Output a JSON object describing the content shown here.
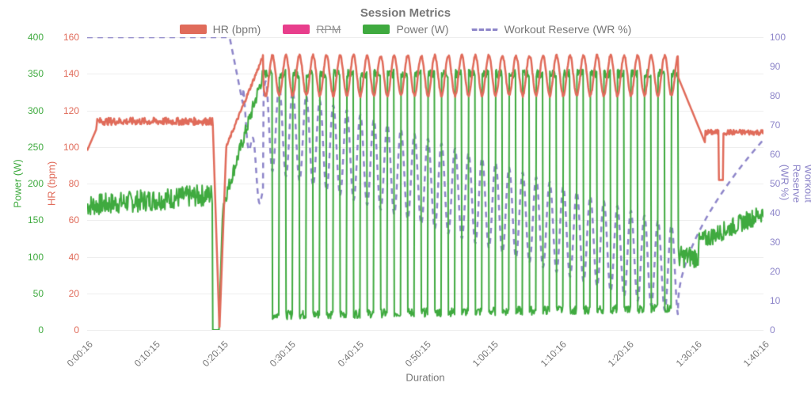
{
  "chart_data": {
    "type": "line",
    "title": "Session Metrics",
    "xlabel": "Duration",
    "x_range_sec": [
      16,
      6016
    ],
    "x_ticks": [
      "0:00:16",
      "0:10:15",
      "0:20:15",
      "0:30:15",
      "0:40:15",
      "0:50:15",
      "1:00:15",
      "1:10:16",
      "1:20:16",
      "1:30:16",
      "1:40:16"
    ],
    "y_axes": {
      "power": {
        "label": "Power (W)",
        "side": "left",
        "color": "#3faa3f",
        "range": [
          0,
          400
        ],
        "ticks": [
          0,
          50,
          100,
          150,
          200,
          250,
          300,
          350,
          400
        ]
      },
      "hr": {
        "label": "HR (bpm)",
        "side": "left",
        "color": "#e06b5a",
        "range": [
          0,
          160
        ],
        "ticks": [
          0,
          20,
          40,
          60,
          80,
          100,
          120,
          140,
          160
        ]
      },
      "wr": {
        "label": "Workout Reserve (WR %)",
        "side": "right",
        "color": "#8d85c9",
        "range": [
          0,
          100
        ],
        "ticks": [
          0,
          10,
          20,
          30,
          40,
          50,
          60,
          70,
          80,
          90,
          100
        ]
      }
    },
    "legend": [
      {
        "key": "hr",
        "label": "HR (bpm)",
        "color": "#e06b5a",
        "visible": true,
        "style": "solid"
      },
      {
        "key": "rpm",
        "label": "RPM",
        "color": "#e83e8c",
        "visible": false,
        "style": "solid"
      },
      {
        "key": "power",
        "label": "Power (W)",
        "color": "#3faa3f",
        "visible": true,
        "style": "solid"
      },
      {
        "key": "wr",
        "label": "Workout Reserve (WR %)",
        "color": "#8d85c9",
        "visible": true,
        "style": "dashed"
      }
    ],
    "series": [
      {
        "name": "Power (W)",
        "key": "power",
        "axis": "power",
        "color": "#3faa3f",
        "phases": {
          "baseline_initial": 170,
          "baseline_drop": {
            "t": [
              1130,
              1190
            ],
            "value": 0
          },
          "ramp": {
            "t": [
              1220,
              1580
            ],
            "from": 170,
            "to": 350
          },
          "interval_block": {
            "t": [
              1600,
              5260
            ],
            "n_intervals": 30,
            "period_sec": 120,
            "duty_cycle": 0.5,
            "high": 350,
            "low": 20,
            "low_rise_to": 30
          },
          "step_after": {
            "t": [
              5260,
              5440
            ],
            "value": 100
          },
          "cooldown_ramp": {
            "t": [
              5440,
              6016
            ],
            "from": 120,
            "to": 160
          }
        }
      },
      {
        "name": "HR (bpm)",
        "key": "hr",
        "axis": "hr",
        "color": "#e06b5a",
        "phases": {
          "rest": {
            "t": [
              16,
              100
            ],
            "from": 98,
            "to": 110
          },
          "warmup_plateau": {
            "t": [
              100,
              1130
            ],
            "value": 114,
            "jitter": 2
          },
          "drop": {
            "t": [
              1130,
              1190
            ],
            "to": 0
          },
          "recover": {
            "t": [
              1190,
              1250
            ],
            "to": 100
          },
          "ramp": {
            "t": [
              1250,
              1580
            ],
            "from": 100,
            "to": 150
          },
          "interval_block": {
            "t": [
              1600,
              5260
            ],
            "n_intervals": 30,
            "period_sec": 120,
            "high": 150,
            "low": 128
          },
          "cooldown": {
            "t": [
              5260,
              5500
            ],
            "to": 102
          },
          "dip": {
            "t": [
              5620,
              5660
            ],
            "to": 82
          },
          "tail": {
            "t": [
              5660,
              6016
            ],
            "value": 108
          }
        }
      },
      {
        "name": "Workout Reserve (WR %)",
        "key": "wr",
        "axis": "wr",
        "color": "#8d85c9",
        "style": "dashed",
        "phases": {
          "full": {
            "t": [
              16,
              1280
            ],
            "value": 100
          },
          "ramp_deplete": {
            "t": [
              1280,
              1580
            ],
            "from": 100,
            "to": 42
          },
          "interval_block": {
            "t": [
              1600,
              5260
            ],
            "n_intervals": 30,
            "period_sec": 120,
            "start_high": 85,
            "end_high": 35,
            "start_low": 55,
            "end_low": 5
          },
          "recover_ramp": {
            "t": [
              5260,
              6016
            ],
            "from": 10,
            "to": 65
          }
        }
      }
    ]
  }
}
